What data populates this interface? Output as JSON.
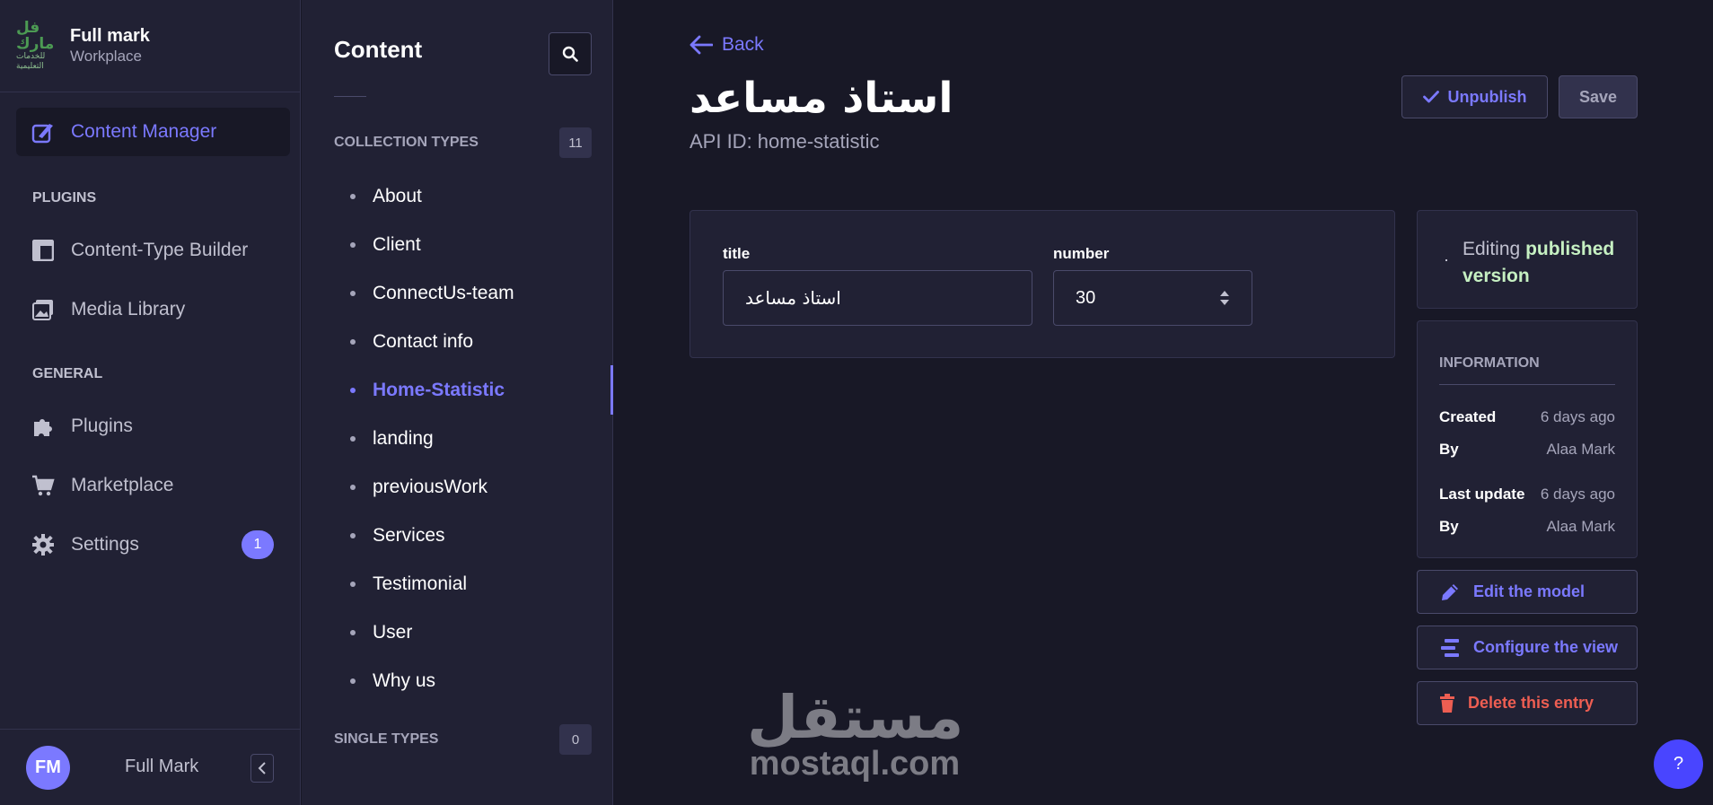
{
  "brand": {
    "logo_text_1": "فل مارك",
    "logo_text_2": "للخدمات التعليمية",
    "title": "Full mark",
    "subtitle": "Workplace"
  },
  "mainnav": {
    "content_manager": "Content Manager",
    "plugins_section": "PLUGINS",
    "content_type_builder": "Content-Type Builder",
    "media_library": "Media Library",
    "general_section": "GENERAL",
    "plugins": "Plugins",
    "marketplace": "Marketplace",
    "settings": "Settings",
    "settings_badge": "1"
  },
  "user": {
    "initials": "FM",
    "name": "Full Mark"
  },
  "subnav": {
    "title": "Content",
    "collection_types_label": "COLLECTION TYPES",
    "collection_types_count": "11",
    "items": [
      "About",
      "Client",
      "ConnectUs-team",
      "Contact info",
      "Home-Statistic",
      "landing",
      "previousWork",
      "Services",
      "Testimonial",
      "User",
      "Why us"
    ],
    "active_item": "Home-Statistic",
    "single_types_label": "SINGLE TYPES",
    "single_types_count": "0"
  },
  "header": {
    "back_label": "Back",
    "title": "استاذ مساعد",
    "api_id": "API ID: home-statistic",
    "unpublish_label": "Unpublish",
    "save_label": "Save"
  },
  "form": {
    "title_label": "title",
    "title_value": "استاذ مساعد",
    "number_label": "number",
    "number_value": "30"
  },
  "sidebar": {
    "editing_prefix": "Editing",
    "editing_strong": "published version",
    "info_title": "INFORMATION",
    "created_label": "Created",
    "created_value": "6 days ago",
    "created_by_label": "By",
    "created_by_value": "Alaa Mark",
    "updated_label": "Last update",
    "updated_value": "6 days ago",
    "updated_by_label": "By",
    "updated_by_value": "Alaa Mark",
    "edit_model": "Edit the model",
    "configure_view": "Configure the view",
    "delete_entry": "Delete this entry"
  },
  "watermark": {
    "arabic": "مستقل",
    "latin": "mostaql.com"
  },
  "help": {
    "label": "?"
  },
  "colors": {
    "accent": "#7b79ff",
    "danger": "#ee5e52",
    "success_text": "#c6f0c2",
    "bg": "#181826",
    "panel": "#212134"
  }
}
